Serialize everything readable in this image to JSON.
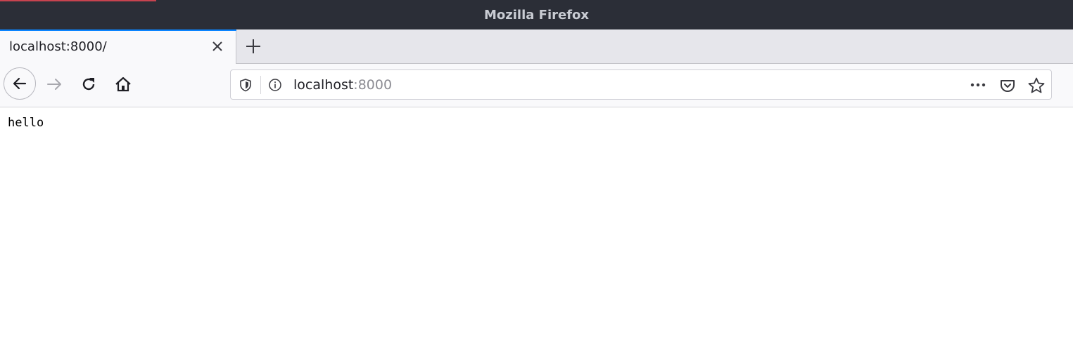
{
  "window": {
    "title": "Mozilla Firefox"
  },
  "tabs": [
    {
      "label": "localhost:8000/",
      "active": true
    }
  ],
  "navbar": {
    "url_host": "localhost",
    "url_port": ":8000"
  },
  "page": {
    "body_text": "hello"
  },
  "colors": {
    "titlebar": "#2b2e37",
    "tab_active_indicator": "#0a84ff",
    "titlebar_accent": "#c7434f"
  },
  "icons": {
    "tab_close": "close-icon",
    "new_tab": "plus-icon",
    "back": "arrow-left-icon",
    "forward": "arrow-right-icon",
    "reload": "reload-icon",
    "home": "home-icon",
    "tracking_protection": "shield-icon",
    "site_info": "info-icon",
    "page_actions": "more-icon",
    "pocket": "pocket-icon",
    "bookmark": "star-icon"
  }
}
